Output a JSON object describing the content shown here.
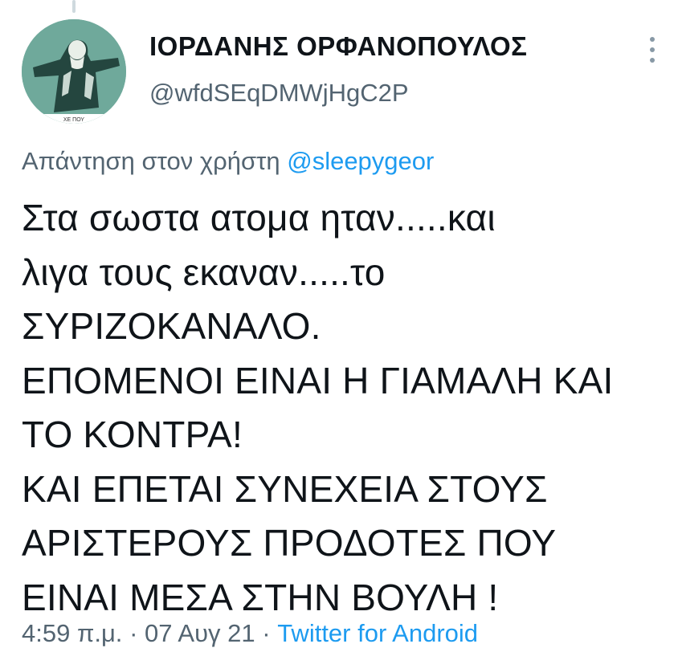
{
  "tweet": {
    "display_name": "ΙΟΡΔΑΝΗΣ ΟΡΦΑΝΟΠΟΥΛΟΣ",
    "handle": "@wfdSEqDMWjHgC2P",
    "avatar_caption": "ΧΕ ΠΟΥ",
    "reply_prefix": "Απάντηση στον χρήστη",
    "reply_to": "@sleepygeor",
    "text": "Στα σωστα ατομα ηταν.....και\nλιγα τους εκαναν.....το\nΣΥΡΙΖΟΚΑΝΑΛΟ.\nΕΠΟΜΕΝΟΙ ΕΙΝΑΙ Η ΓΙΑΜΑΛΗ ΚΑΙ\nΤΟ ΚΟΝΤΡΑ!\nΚΑΙ ΕΠΕΤΑΙ ΣΥΝΕΧΕΙΑ ΣΤΟΥΣ\nΑΡΙΣΤΕΡΟΥΣ ΠΡΟΔΟΤΕΣ ΠΟΥ\nΕΙΝΑΙ ΜΕΣΑ ΣΤΗΝ ΒΟΥΛΗ !",
    "time": "4:59 π.μ.",
    "separator": "·",
    "date": "07 Αυγ 21",
    "source": "Twitter for Android"
  },
  "colors": {
    "text": "#0f1419",
    "secondary": "#536471",
    "link": "#1d9bf0",
    "avatar_bg": "#6fa99b"
  },
  "icons": {
    "more": "more-vertical-icon"
  }
}
